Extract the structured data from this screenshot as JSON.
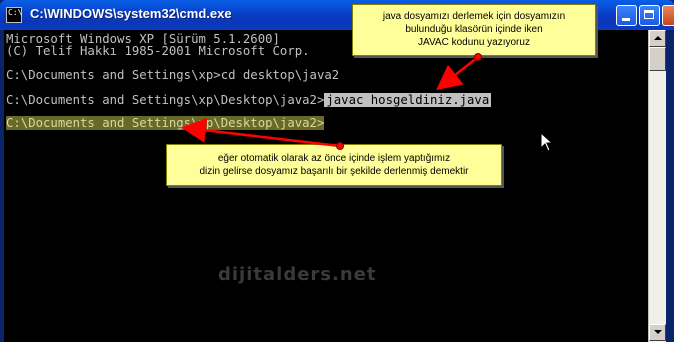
{
  "window": {
    "title": "C:\\WINDOWS\\system32\\cmd.exe",
    "icon_text": "C:\\",
    "titlebar_color": "#0a5ee6"
  },
  "console": {
    "lines": [
      "Microsoft Windows XP [Sürüm 5.1.2600]",
      "(C) Telif Hakkı 1985-2001 Microsoft Corp.",
      "",
      "C:\\Documents and Settings\\xp>cd desktop\\java2",
      "",
      "C:\\Documents and Settings\\xp\\Desktop\\java2>",
      "javac hosgeldiniz.java",
      "",
      "C:\\Documents and Settings\\xp\\Desktop\\java2>"
    ],
    "background": "#000000",
    "text_color": "#c0c0c0"
  },
  "annotations": {
    "note1": [
      "java dosyamızı derlemek için dosyamızın",
      "bulunduğu klasörün içinde iken",
      "JAVAC kodunu yazıyoruz"
    ],
    "note2": [
      "eğer otomatik olarak az önce içinde işlem yaptığımız",
      "dizin gelirse dosyamız başarılı bir şekilde derlenmiş demektir"
    ],
    "note_color": "#ffff99",
    "arrow_color": "#ff0000"
  },
  "watermark": "dijitalders.net",
  "icons": {
    "minimize": "minimize-icon",
    "maximize": "maximize-icon",
    "close": "close-icon",
    "app": "cmd-app-icon",
    "cursor": "mouse-pointer-icon"
  }
}
